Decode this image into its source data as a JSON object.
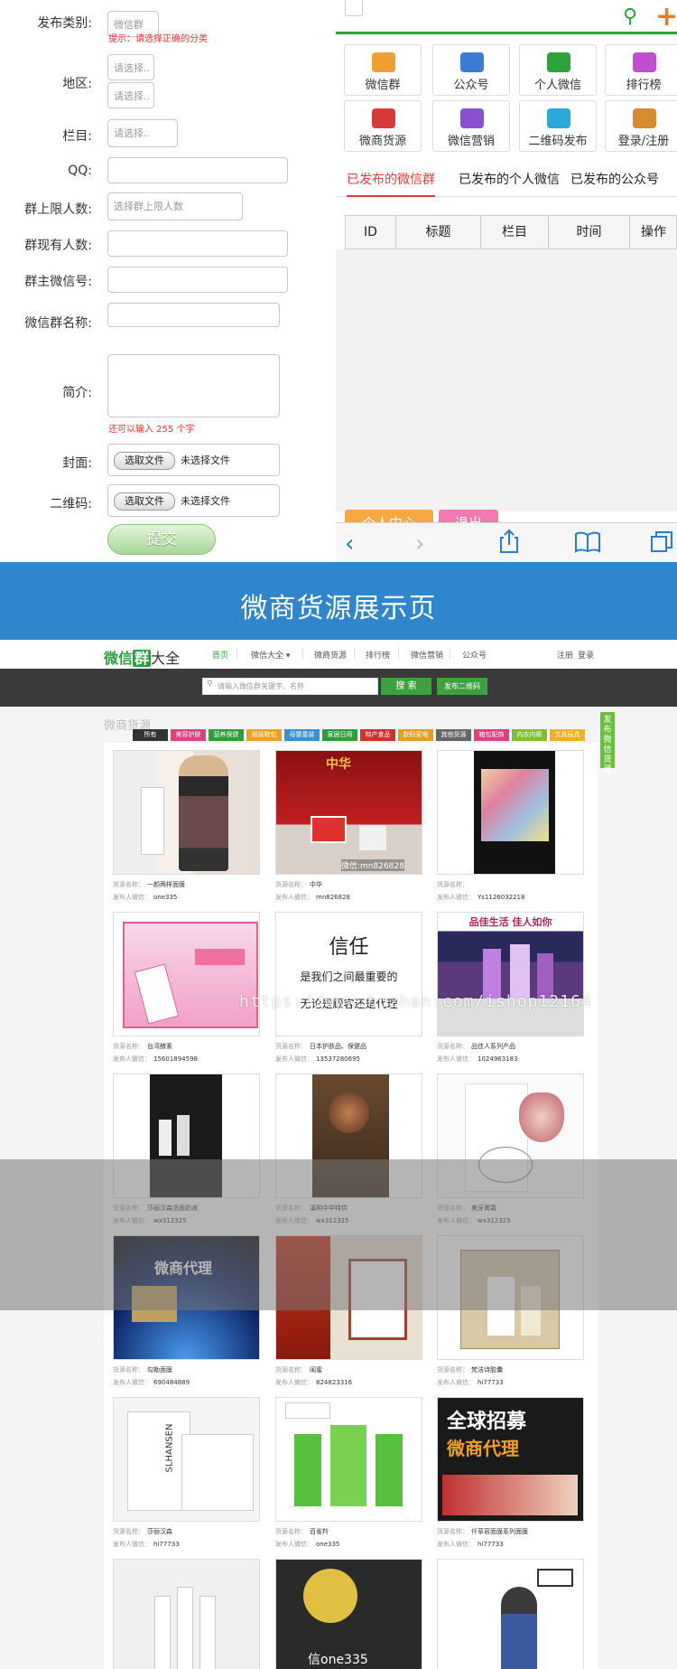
{
  "form": {
    "labels": {
      "category": "发布类别:",
      "region": "地区:",
      "column": "栏目:",
      "qq": "QQ:",
      "limit": "群上限人数:",
      "current": "群现有人数:",
      "owner": "群主微信号:",
      "name": "微信群名称:",
      "intro": "简介:",
      "cover": "封面:",
      "qrcode": "二维码:"
    },
    "category_value": "微信群",
    "category_hint": "提示：请选择正确的分类",
    "region_placeholder_1": "请选择..",
    "region_placeholder_2": "请选择..",
    "column_placeholder": "请选择..",
    "limit_placeholder": "选择群上限人数",
    "intro_hint": "还可以输入 255 个字",
    "file_button": "选取文件",
    "file_status": "未选择文件",
    "submit": "提交"
  },
  "mobile": {
    "tiles": [
      {
        "label": "微信群",
        "color": "#f0a030"
      },
      {
        "label": "公众号",
        "color": "#3a7bd4"
      },
      {
        "label": "个人微信",
        "color": "#2ea33b"
      },
      {
        "label": "排行榜",
        "color": "#c04fd0"
      },
      {
        "label": "微商货源",
        "color": "#d83a3a"
      },
      {
        "label": "微信营销",
        "color": "#8a4fd0"
      },
      {
        "label": "二维码发布",
        "color": "#2aa8d8"
      },
      {
        "label": "登录/注册",
        "color": "#d88a30"
      }
    ],
    "tabs": [
      "已发布的微信群",
      "已发布的个人微信",
      "已发布的公众号"
    ],
    "table_headers": [
      "ID",
      "标题",
      "栏目",
      "时间",
      "操作"
    ],
    "buttons": {
      "user_center": "个人中心",
      "logout": "退出"
    }
  },
  "banner_title": "微商货源展示页",
  "site": {
    "logo": {
      "pre": "微信",
      "mid": "群",
      "post": "大全"
    },
    "nav": [
      "首页",
      "微信大全 ▾",
      "微商货源",
      "排行榜",
      "微信营销",
      "公众号"
    ],
    "nav_right": [
      "注册",
      "登录"
    ],
    "search_placeholder": "请输入微信群关键字、名称",
    "search_button": "搜 索",
    "publish_button": "发布二维码",
    "section_title": "微商货源",
    "side_tab": "发布微信货源",
    "categories": [
      {
        "label": "所有",
        "color": "#333333"
      },
      {
        "label": "美容护肤",
        "color": "#e04080"
      },
      {
        "label": "营养保健",
        "color": "#2e9e3a"
      },
      {
        "label": "服装鞋包",
        "color": "#f0a020"
      },
      {
        "label": "母婴童装",
        "color": "#3a8fd0"
      },
      {
        "label": "家居日用",
        "color": "#2e9e3a"
      },
      {
        "label": "特产食品",
        "color": "#d03030"
      },
      {
        "label": "数码家电",
        "color": "#e0a020"
      },
      {
        "label": "其他货源",
        "color": "#666666"
      },
      {
        "label": "箱包配饰",
        "color": "#e04080"
      },
      {
        "label": "内衣内裤",
        "color": "#80c030"
      },
      {
        "label": "文具玩具",
        "color": "#f0b020"
      }
    ],
    "card_label_name": "货源名称：",
    "card_label_wechat": "发布人微信：",
    "cards": [
      {
        "name": "一颜两样面膜",
        "wechat": "one335"
      },
      {
        "name": "中华",
        "wechat": "mn826828"
      },
      {
        "name": "",
        "wechat": "Ys1126032218"
      },
      {
        "name": "台湾酵素",
        "wechat": "15601894598"
      },
      {
        "name": "日本护肤品、保健品",
        "wechat": "13537280695"
      },
      {
        "name": "品佳人系列产品",
        "wechat": "1024963183"
      },
      {
        "name": "莎丽汉森洗面奶液",
        "wechat": "wx312325"
      },
      {
        "name": "溪明中华特供",
        "wechat": "wx312325"
      },
      {
        "name": "美牙膏霜",
        "wechat": "wx312325"
      },
      {
        "name": "勾勒面膜",
        "wechat": "690484889"
      },
      {
        "name": "闺蜜",
        "wechat": "824823316"
      },
      {
        "name": "梵洁诗胶囊",
        "wechat": "hi77733"
      },
      {
        "name": "莎丽汉森",
        "wechat": "hi77733"
      },
      {
        "name": "百雀羚",
        "wechat": "one335"
      },
      {
        "name": "仟草容面膜系列面膜",
        "wechat": "hi77733"
      },
      {
        "name": "",
        "wechat": ""
      },
      {
        "name": "",
        "wechat": ""
      },
      {
        "name": "",
        "wechat": ""
      }
    ],
    "card_image_texts": {
      "c1_badge": "微信:mn826828",
      "c1_top": "中华",
      "c4_line1": "信任",
      "c4_line2": "是我们之间最重要的",
      "c4_line3": "无论是顾客还是代理",
      "c5_banner": "品佳生活 佳人如你",
      "c9_banner": "微商代理",
      "c12_brand": "SLHANSEN",
      "c14_line1": "全球招募",
      "c14_line2": "微商代理",
      "c16_text": "信one335"
    }
  },
  "watermark": "https://www.huzhan.com/ishop12164"
}
